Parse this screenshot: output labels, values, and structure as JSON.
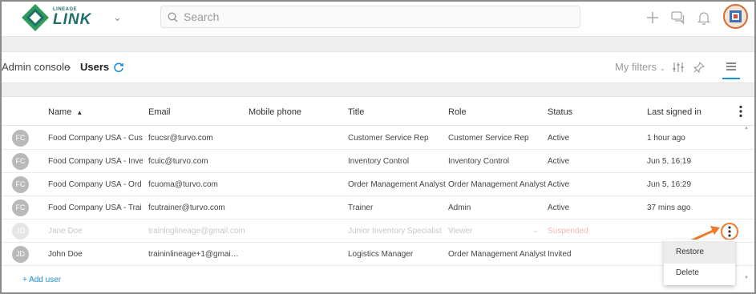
{
  "brand": {
    "small": "LINEAGE",
    "name": "LINK"
  },
  "search": {
    "placeholder": "Search"
  },
  "breadcrumb": {
    "parent": "Admin console",
    "separator": "›",
    "current": "Users"
  },
  "toolbar": {
    "my_filters": "My filters"
  },
  "table": {
    "columns": [
      "Name",
      "Email",
      "Mobile phone",
      "Title",
      "Role",
      "Status",
      "Last signed in"
    ],
    "sorted_column": "Name",
    "rows": [
      {
        "initials": "FC",
        "name": "Food Company USA - Cus…",
        "email": "fcucsr@turvo.com",
        "phone": "",
        "title": "Customer Service Rep",
        "role": "Customer Service Rep",
        "status": "Active",
        "last": "1 hour ago"
      },
      {
        "initials": "FC",
        "name": "Food Company USA - Inve…",
        "email": "fcuic@turvo.com",
        "phone": "",
        "title": "Inventory Control",
        "role": "Inventory Control",
        "status": "Active",
        "last": "Jun 5, 16:19"
      },
      {
        "initials": "FC",
        "name": "Food Company USA - Ord…",
        "email": "fcuoma@turvo.com",
        "phone": "",
        "title": "Order Management Analyst",
        "role": "Order Management Analyst",
        "status": "Active",
        "last": "Jun 5, 16:29"
      },
      {
        "initials": "FC",
        "name": "Food Company USA - Trai…",
        "email": "fcutrainer@turvo.com",
        "phone": "",
        "title": "Trainer",
        "role": "Admin",
        "status": "Active",
        "last": "37 mins ago"
      },
      {
        "initials": "JD",
        "name": "Jane Doe",
        "email": "traininglineage@gmail.com",
        "phone": "",
        "title": "Junior Inventory Specialist",
        "role": "Viewer",
        "status": "Suspended",
        "last": ""
      },
      {
        "initials": "JD",
        "name": "John Doe",
        "email": "traininlineage+1@gmai…",
        "phone": "",
        "title": "Logistics Manager",
        "role": "Order Management Analyst",
        "status": "Invited",
        "last": ""
      }
    ],
    "add_user": "+ Add user"
  },
  "context_menu": {
    "items": [
      "Restore",
      "Delete"
    ]
  },
  "colors": {
    "accent": "#1d8fd6",
    "highlight": "#f07a2a",
    "brand": "#1f6f6a"
  }
}
